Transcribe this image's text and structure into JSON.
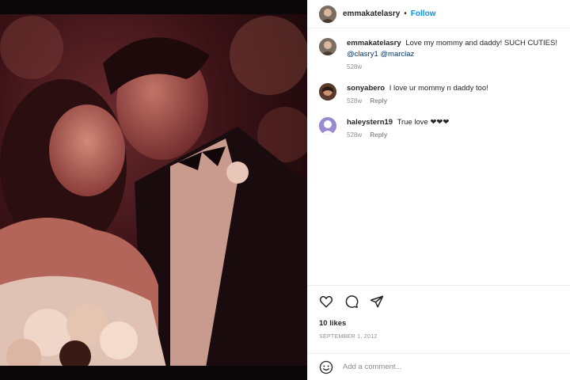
{
  "post": {
    "username": "emmakatelasry",
    "follow_label": "Follow",
    "separator": "•",
    "photo_icon": "wedding-couple-photo"
  },
  "caption": {
    "username": "emmakatelasry",
    "text": "Love my mommy and daddy! SUCH CUTIES!",
    "mention1": "@clasry1",
    "mention2": "@marclaz",
    "time": "528w"
  },
  "comments": [
    {
      "username": "sonyabero",
      "text": "I love ur mommy n daddy too!",
      "time": "528w",
      "reply": "Reply"
    },
    {
      "username": "haleystern19",
      "text": "True love ❤❤❤",
      "time": "528w",
      "reply": "Reply"
    }
  ],
  "actions": {
    "icons": [
      "heart-icon",
      "comment-icon",
      "share-icon"
    ],
    "likes": "10 likes",
    "date": "SEPTEMBER 1, 2012"
  },
  "add_comment": {
    "placeholder": "Add a comment...",
    "icon": "emoji-icon"
  },
  "colors": {
    "accent": "#0095f6",
    "text": "#262626",
    "muted": "#8e8e8e",
    "photo_tint": "#5a1420"
  }
}
